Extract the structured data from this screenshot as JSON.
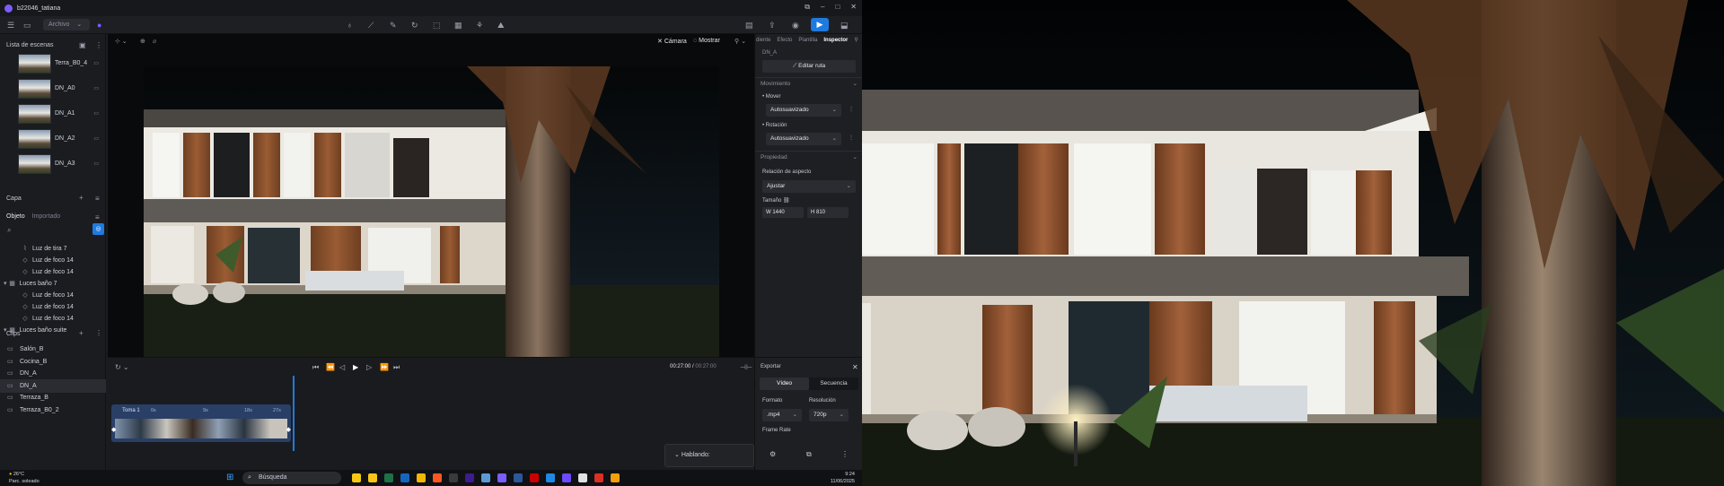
{
  "window": {
    "title": "b22046_tatiana",
    "controls": [
      "⧉",
      "–",
      "□",
      "✕"
    ]
  },
  "toolbar": {
    "mode_label": "Archivo"
  },
  "left_panel": {
    "scenes_title": "Lista de escenas",
    "scenes": [
      "Terra_B0_4",
      "DN_A0",
      "DN_A1",
      "DN_A2",
      "DN_A3"
    ],
    "layer_title": "Capa",
    "tabs": {
      "object": "Objeto",
      "imported": "Importado"
    },
    "tree": [
      {
        "label": "Luz de tira 7",
        "icon": "light-strip-icon",
        "indent": 2
      },
      {
        "label": "Luz de foco 14",
        "icon": "spotlight-icon",
        "indent": 2
      },
      {
        "label": "Luz de foco 14",
        "icon": "spotlight-icon",
        "indent": 2
      },
      {
        "label": "Luces baño 7",
        "icon": "group-icon",
        "indent": 1
      },
      {
        "label": "Luz de foco 14",
        "icon": "spotlight-icon",
        "indent": 2
      },
      {
        "label": "Luz de foco 14",
        "icon": "spotlight-icon",
        "indent": 2
      },
      {
        "label": "Luz de foco 14",
        "icon": "spotlight-icon",
        "indent": 2
      },
      {
        "label": "Luces baño suite",
        "icon": "group-icon",
        "indent": 1
      }
    ],
    "clips_title": "Clips",
    "clips": [
      "Salón_B",
      "Cocina_B",
      "DN_A",
      "DN_A",
      "Terraza_B",
      "Terraza_B0_2"
    ],
    "selected_clip": 3
  },
  "viewport": {
    "camera_label": "Cámara",
    "show_label": "Mostrar"
  },
  "timeline": {
    "time_current": "00:27:00",
    "time_total": "00:27:00",
    "clip": {
      "name": "Toma 1",
      "ticks": [
        "0s",
        "9s",
        "18s",
        "27s"
      ]
    },
    "speaking_label": "Hablando:"
  },
  "inspector": {
    "tabs": [
      "diente",
      "Efecto",
      "Plantilla",
      "Inspector"
    ],
    "active_tab": 3,
    "object_name": "DN_A",
    "edit_path": "Editar ruta",
    "movement_title": "Movimiento",
    "move_label": "• Mover",
    "move_value": "Autosuavizado",
    "rotation_label": "• Rotación",
    "rotation_value": "Autosuavizado",
    "property_title": "Propiedad",
    "aspect_label": "Relación de aspecto",
    "aspect_value": "Ajustar",
    "size_label": "Tamaño",
    "width": "W  1440",
    "height": "H  810"
  },
  "export": {
    "title": "Exportar",
    "tabs": [
      "Vídeo",
      "Secuencia"
    ],
    "format_label": "Formato",
    "format_value": ".mp4",
    "resolution_label": "Resolución",
    "resolution_value": "720p",
    "framerate_label": "Frame Rate"
  },
  "taskbar": {
    "weather_temp": "26°C",
    "weather_desc": "Parc. soleado",
    "search_label": "Búsqueda",
    "clock_time": "9:24",
    "clock_date": "11/06/2025",
    "apps": [
      "#f2c811",
      "#f5c518",
      "#1e7145",
      "#1565c0",
      "#f2b705",
      "#ff5722",
      "#3a3a3a",
      "#3d1c8f",
      "#5b9bd5",
      "#7b5cff",
      "#2b579a",
      "#cc0000",
      "#1e88e5",
      "#6d4aff",
      "#e0e0e0",
      "#d93025",
      "#f59e0b"
    ]
  }
}
